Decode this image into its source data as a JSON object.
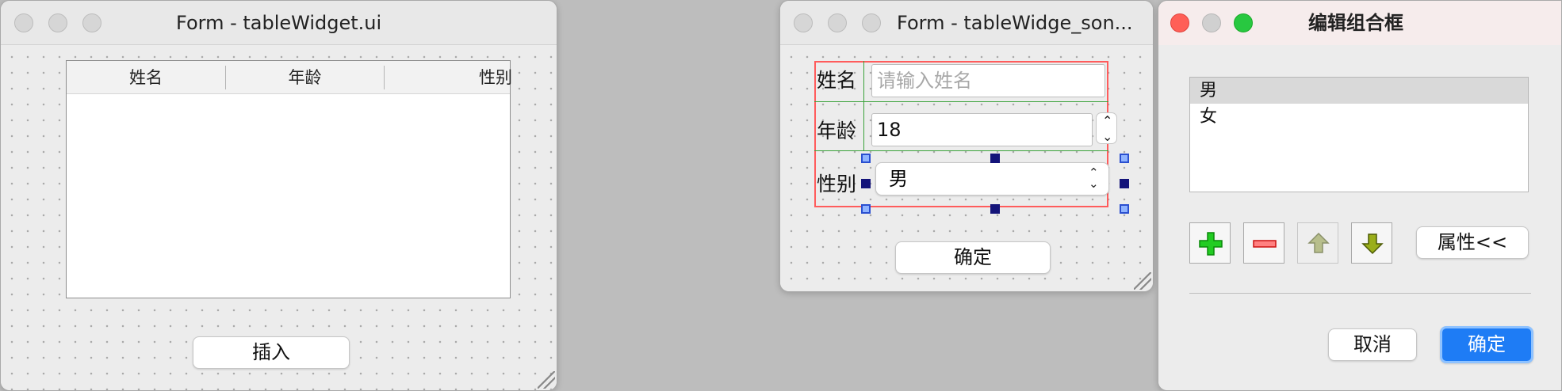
{
  "window1": {
    "title": "Form - tableWidget.ui",
    "columns": [
      "姓名",
      "年龄",
      "性别"
    ],
    "insert_button": "插入"
  },
  "window2": {
    "title": "Form - tableWidge_son...",
    "name_label": "姓名",
    "name_placeholder": "请输入姓名",
    "age_label": "年龄",
    "age_value": "18",
    "gender_label": "性别",
    "gender_value": "男",
    "ok_button": "确定"
  },
  "window3": {
    "title": "编辑组合框",
    "items": [
      "男",
      "女"
    ],
    "selected_item": "男",
    "properties_button": "属性<<",
    "cancel_button": "取消",
    "ok_button": "确定"
  },
  "icons": [
    "add-icon",
    "remove-icon",
    "move-up-icon",
    "move-down-icon",
    "resize-grip-icon"
  ],
  "colors": {
    "accent": "#1e7cf5",
    "close": "#ff5f57",
    "zoom": "#28c840",
    "layout_red": "#ff5c5c",
    "layout_green": "#39a239",
    "handle": "#14147a"
  }
}
